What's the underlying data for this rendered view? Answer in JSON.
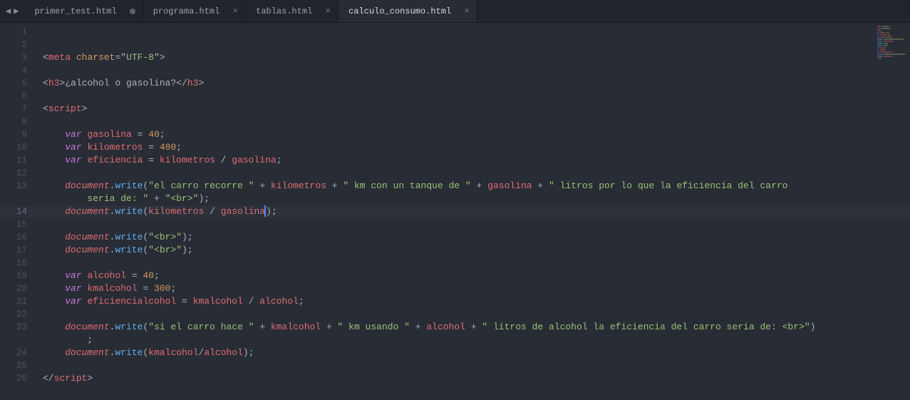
{
  "tabs": [
    {
      "label": "primer_test.html",
      "modified": true,
      "active": false
    },
    {
      "label": "programa.html",
      "modified": false,
      "active": false
    },
    {
      "label": "tablas.html",
      "modified": false,
      "active": false
    },
    {
      "label": "calculo_consumo.html",
      "modified": false,
      "active": true
    }
  ],
  "arrows": {
    "left": "◀",
    "right": "▶"
  },
  "close_glyph": "×",
  "mod_glyph": "●",
  "current_line": 14,
  "line_count": 26,
  "code": {
    "l3": {
      "tag_open": "<",
      "tag": "meta",
      "sp": " ",
      "attr": "charset",
      "eq": "=",
      "q": "\"",
      "val": "UTF-8",
      "tag_close": ">"
    },
    "l5": {
      "open_l": "<",
      "h3": "h3",
      "open_r": ">",
      "text": "¿alcohol o gasolina?",
      "close_l": "</",
      "close_r": ">"
    },
    "l7": {
      "open_l": "<",
      "tag": "script",
      "open_r": ">"
    },
    "l9": {
      "kw": "var",
      "name": "gasolina",
      "eq": " = ",
      "num": "40",
      "semi": ";"
    },
    "l10": {
      "kw": "var",
      "name": "kilometros",
      "eq": " = ",
      "num": "480",
      "semi": ";"
    },
    "l11": {
      "kw": "var",
      "name": "eficiencia",
      "eq": " = ",
      "a": "kilometros",
      "op": " / ",
      "b": "gasolina",
      "semi": ";"
    },
    "l13": {
      "obj": "document",
      "dot": ".",
      "fn": "write",
      "lp": "(",
      "s1": "\"el carro recorre \"",
      "p1": " + ",
      "v1": "kilometros",
      "p2": " + ",
      "s2": "\" km con un tanque de \"",
      "p3": " + ",
      "v2": "gasolina",
      "p4": " + ",
      "s3": "\" litros por lo que la eficiencia del carro "
    },
    "l13b": {
      "s3b": "seria de: \"",
      "p5": " + ",
      "s4": "\"<br>\"",
      "rp": ")",
      "semi": ";"
    },
    "l14": {
      "obj": "document",
      "dot": ".",
      "fn": "write",
      "lp": "(",
      "a": "kilometros",
      "op": " / ",
      "b": "gasolina",
      "rp": ")",
      "semi": ";"
    },
    "l16": {
      "obj": "document",
      "dot": ".",
      "fn": "write",
      "lp": "(",
      "s": "\"<br>\"",
      "rp": ")",
      "semi": ";"
    },
    "l17": {
      "obj": "document",
      "dot": ".",
      "fn": "write",
      "lp": "(",
      "s": "\"<br>\"",
      "rp": ")",
      "semi": ";"
    },
    "l19": {
      "kw": "var",
      "name": "alcohol",
      "eq": " = ",
      "num": "40",
      "semi": ";"
    },
    "l20": {
      "kw": "var",
      "name": "kmalcohol",
      "eq": " = ",
      "num": "300",
      "semi": ";"
    },
    "l21": {
      "kw": "var",
      "name": "eficiencialcohol",
      "eq": " = ",
      "a": "kmalcohol",
      "op": " / ",
      "b": "alcohol",
      "semi": ";"
    },
    "l23": {
      "obj": "document",
      "dot": ".",
      "fn": "write",
      "lp": "(",
      "s1": "\"si el carro hace \"",
      "p1": " + ",
      "v1": "kmalcohol",
      "p2": " + ",
      "s2": "\" km usando \"",
      "p3": " + ",
      "v2": "alcohol",
      "p4": " + ",
      "s3": "\" litros de alcohol la eficiencia del carro seria de: <br>\"",
      "rp": ")"
    },
    "l23b": {
      "semi": ";"
    },
    "l24": {
      "obj": "document",
      "dot": ".",
      "fn": "write",
      "lp": "(",
      "a": "kmalcohol",
      "op": "/",
      "b": "alcohol",
      "rp": ")",
      "semi": ";"
    },
    "l26": {
      "close_l": "</",
      "tag": "script",
      "close_r": ">"
    }
  }
}
